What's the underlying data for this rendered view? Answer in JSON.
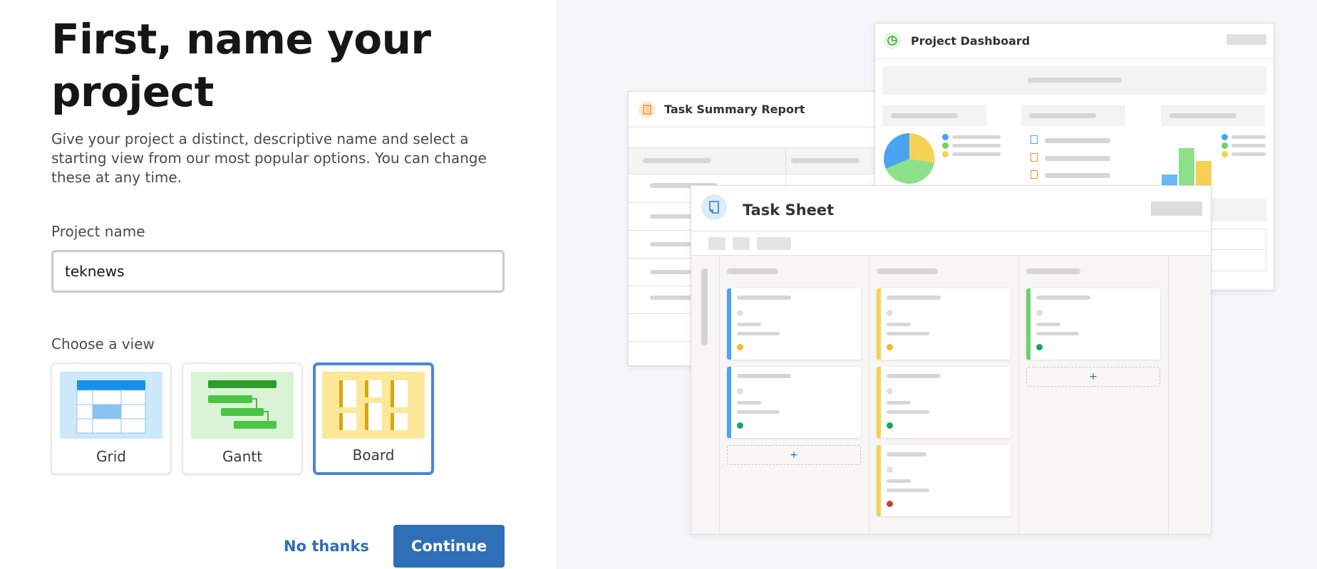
{
  "form": {
    "title": "First, name your project",
    "description": "Give your project a distinct, descriptive name and select a starting view from our most popular options. You can change these at any time.",
    "project_name_label": "Project name",
    "project_name_value": "teknews",
    "choose_view_label": "Choose a view",
    "views": [
      {
        "label": "Grid",
        "icon": "grid-view-thumbnail",
        "selected": false
      },
      {
        "label": "Gantt",
        "icon": "gantt-view-thumbnail",
        "selected": false
      },
      {
        "label": "Board",
        "icon": "board-view-thumbnail",
        "selected": true
      }
    ],
    "no_thanks_label": "No thanks",
    "continue_label": "Continue"
  },
  "preview": {
    "report_title": "Task Summary Report",
    "dashboard_title": "Project Dashboard",
    "sheet_title": "Task Sheet",
    "add_symbol": "+",
    "colors": {
      "blue": "#4aa3f0",
      "yellow": "#f7d154",
      "green": "#6dd16a",
      "dot_green": "#10a860",
      "dot_red": "#d43b3b",
      "dot_orange": "#f5b82e",
      "accent": "#2f6fb8"
    }
  }
}
